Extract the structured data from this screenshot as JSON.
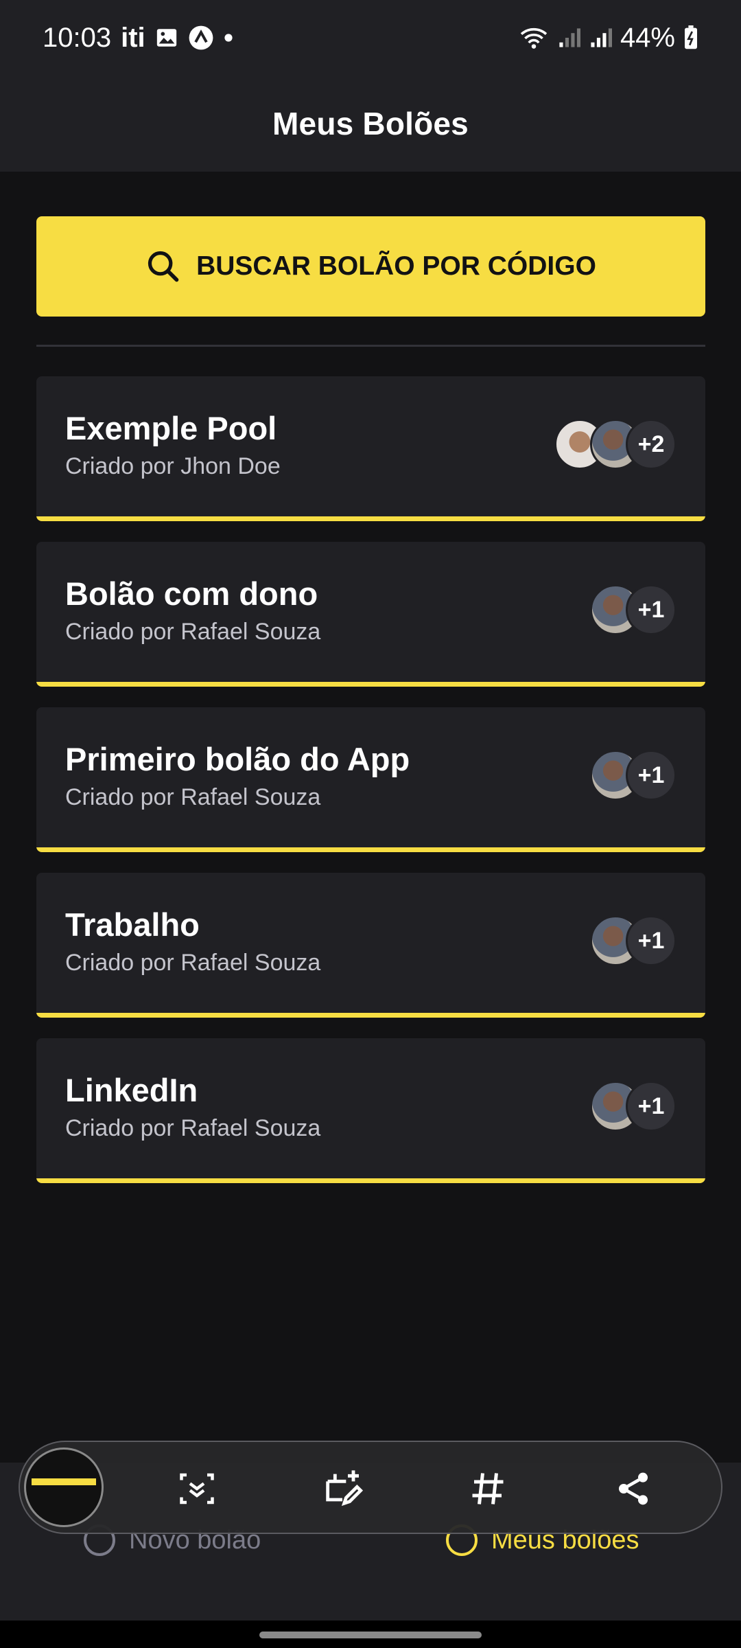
{
  "status_bar": {
    "time": "10:03",
    "carrier_logo": "iti",
    "battery": "44%"
  },
  "header": {
    "title": "Meus Bolões"
  },
  "search_button": {
    "label": "BUSCAR BOLÃO POR CÓDIGO",
    "icon": "search-icon",
    "color": "#F7DD43"
  },
  "pools": [
    {
      "title": "Exemple Pool",
      "owner": "Criado por Jhon Doe",
      "extra_participants": "+2"
    },
    {
      "title": "Bolão com dono",
      "owner": "Criado por Rafael Souza",
      "extra_participants": "+1"
    },
    {
      "title": "Primeiro bolão do App",
      "owner": "Criado por Rafael Souza",
      "extra_participants": "+1"
    },
    {
      "title": "Trabalho",
      "owner": "Criado por Rafael Souza",
      "extra_participants": "+1"
    },
    {
      "title": "LinkedIn",
      "owner": "Criado por Rafael Souza",
      "extra_participants": "+1"
    }
  ],
  "bottom_nav": {
    "new_pool": "Novo bolão",
    "my_pools": "Meus bolões",
    "active_color": "#F7DD43",
    "inactive_color": "#7C7C8A"
  },
  "screenshot_toolbar": {
    "tools": [
      "scroll-capture-icon",
      "edit-crop-icon",
      "hashtag-icon",
      "share-icon"
    ]
  }
}
